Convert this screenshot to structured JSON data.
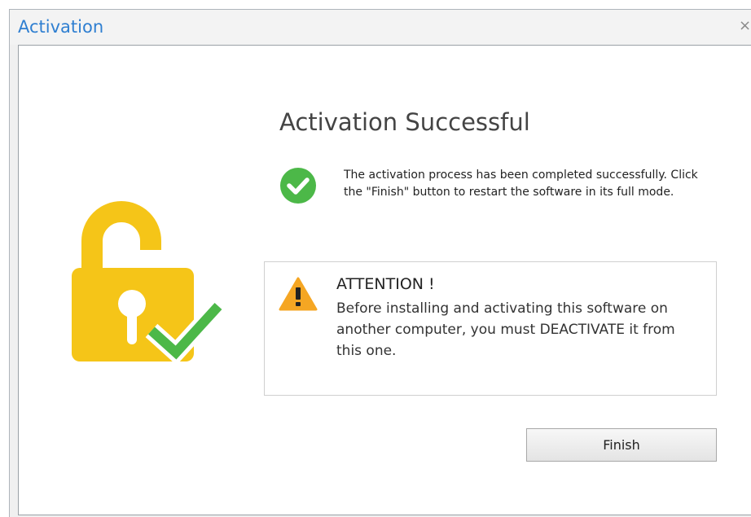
{
  "window": {
    "title": "Activation",
    "close_glyph": "×"
  },
  "main": {
    "heading": "Activation Successful",
    "success_message": "The activation process has been completed successfully. Click the \"Finish\" button to restart the software in its full mode.",
    "attention": {
      "title": "ATTENTION !",
      "text": "Before installing and activating this software on another computer, you must DEACTIVATE it from this one."
    },
    "finish_label": "Finish"
  },
  "icons": {
    "illustration": "unlocked-padlock-with-checkmark",
    "success": "check-circle-icon",
    "warning": "warning-triangle-icon",
    "close": "close-icon"
  },
  "colors": {
    "title_text": "#2f7fd1",
    "lock_yellow": "#f5c518",
    "check_green": "#4cb848",
    "warning_orange": "#f5a623"
  }
}
